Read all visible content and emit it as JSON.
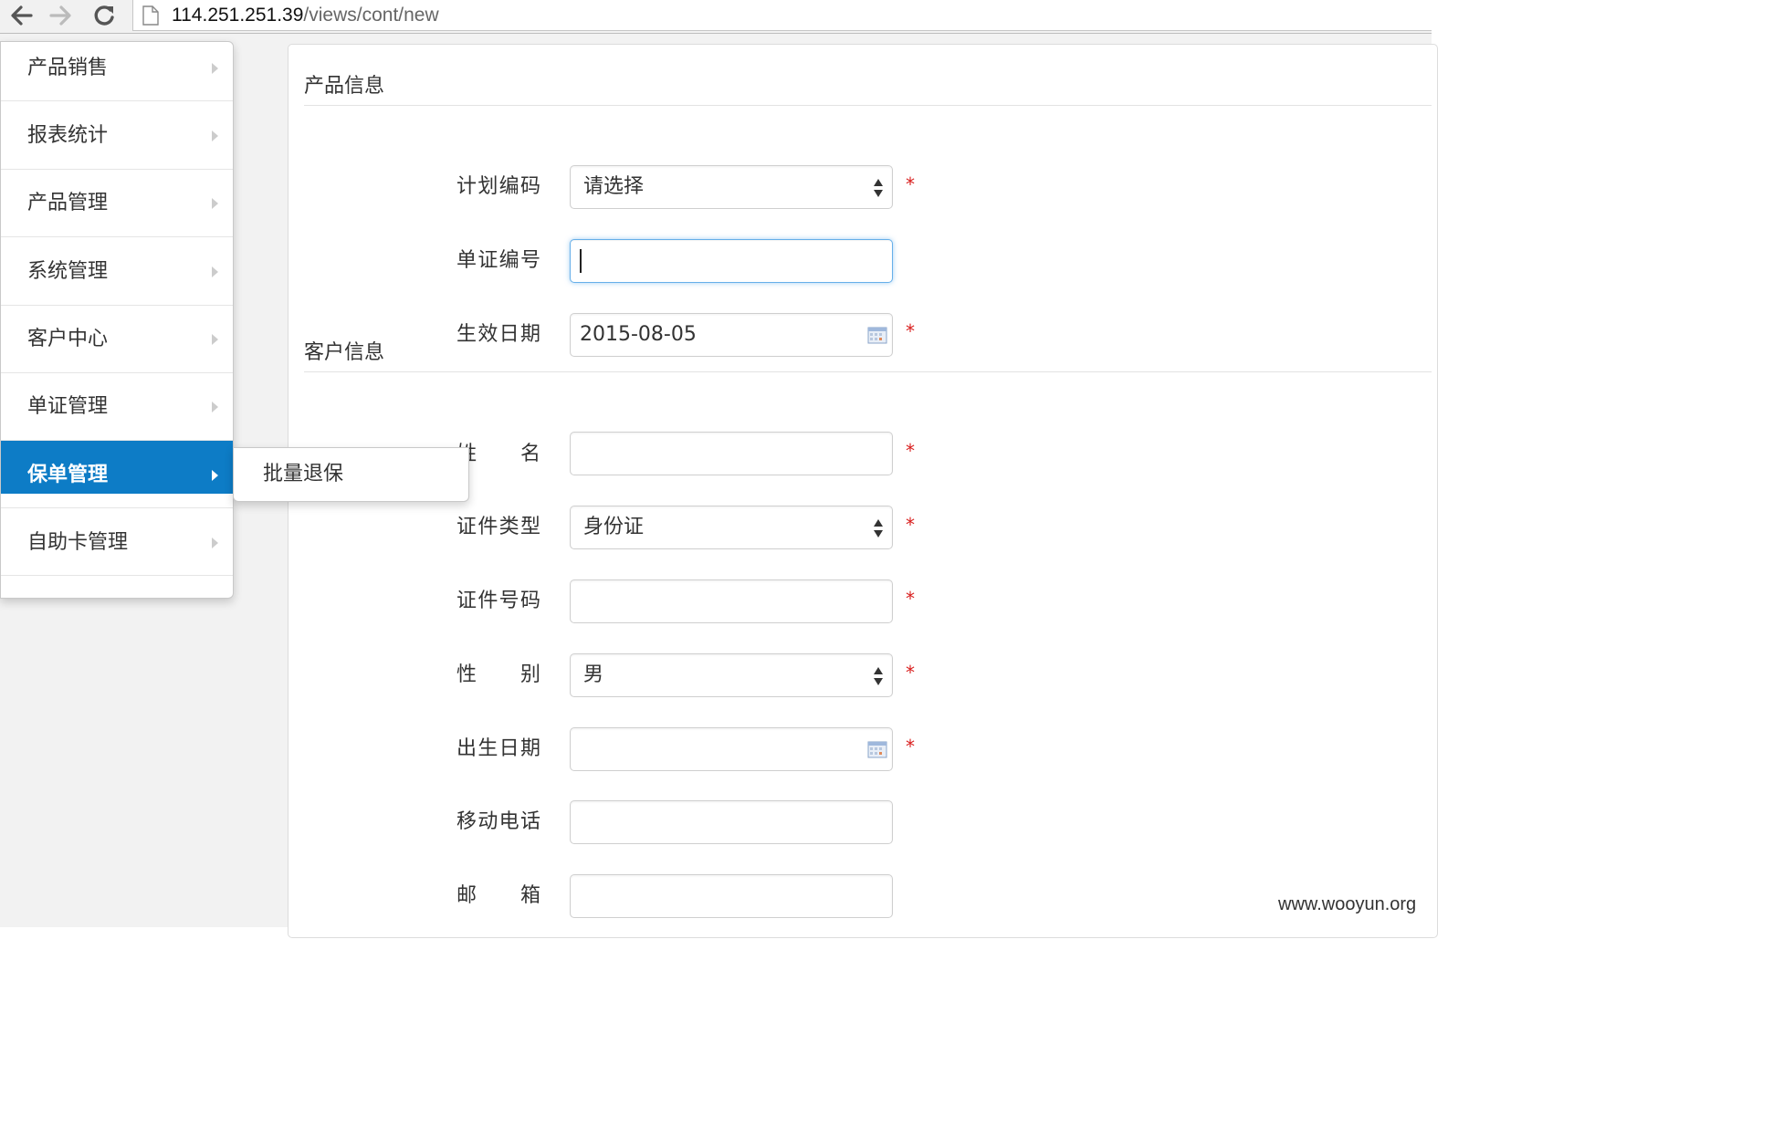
{
  "browser": {
    "url_host": "114.251.251.39",
    "url_path": "/views/cont/new",
    "icons": [
      "back-arrow-icon",
      "forward-arrow-icon",
      "reload-icon",
      "page-icon"
    ]
  },
  "sidebar": {
    "items": [
      {
        "label": "产品销售"
      },
      {
        "label": "报表统计"
      },
      {
        "label": "产品管理"
      },
      {
        "label": "系统管理"
      },
      {
        "label": "客户中心"
      },
      {
        "label": "单证管理"
      },
      {
        "label": "保单管理",
        "active": true
      },
      {
        "label": "自助卡管理"
      }
    ],
    "submenu": {
      "label": "批量退保"
    },
    "active_color": "#0d7cc6"
  },
  "sections": {
    "product": {
      "title": "产品信息"
    },
    "customer": {
      "title": "客户信息"
    }
  },
  "form": {
    "plan_code": {
      "label": "计划编码",
      "value": "请选择"
    },
    "doc_number": {
      "label": "单证编号",
      "value": ""
    },
    "effective_date": {
      "label": "生效日期",
      "value": "2015-08-05"
    },
    "name": {
      "label": "姓　名",
      "value": ""
    },
    "id_type": {
      "label": "证件类型",
      "value": "身份证"
    },
    "id_number": {
      "label": "证件号码",
      "value": ""
    },
    "gender": {
      "label": "性　别",
      "value": "男"
    },
    "birth_date": {
      "label": "出生日期",
      "value": ""
    },
    "mobile": {
      "label": "移动电话",
      "value": ""
    },
    "email": {
      "label": "邮　箱",
      "value": ""
    },
    "required_mark": "*",
    "required_color": "#d9201f"
  },
  "watermark": "www.wooyun.org"
}
